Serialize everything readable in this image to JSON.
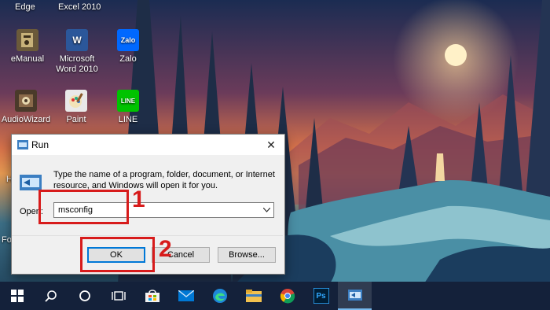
{
  "desktop": {
    "top_labels": [
      "Edge",
      "Excel 2010"
    ],
    "icons": [
      {
        "label_lines": [
          "eManual"
        ],
        "icon": "emanual-icon"
      },
      {
        "label_lines": [
          "Microsoft",
          "Word 2010"
        ],
        "icon": "word-icon",
        "glyph": "W"
      },
      {
        "label_lines": [
          "Zalo"
        ],
        "icon": "zalo-icon",
        "glyph": "Zalo"
      },
      {
        "label_lines": [
          "AudioWizard"
        ],
        "icon": "audiowizard-icon"
      },
      {
        "label_lines": [
          "Paint"
        ],
        "icon": "paint-icon"
      },
      {
        "label_lines": [
          "LINE"
        ],
        "icon": "line-icon",
        "glyph": "LINE"
      }
    ],
    "partial_labels": [
      "H",
      "Fo"
    ]
  },
  "run_dialog": {
    "title": "Run",
    "description": "Type the name of a program, folder, document, or Internet resource, and Windows will open it for you.",
    "open_label": "Open:",
    "open_value": "msconfig",
    "ok_label": "OK",
    "cancel_label": "Cancel",
    "browse_label": "Browse..."
  },
  "annotations": {
    "step1": "1",
    "step2": "2",
    "color": "#d71b1b"
  },
  "taskbar": {
    "items": [
      "start-icon",
      "search-icon",
      "cortana-icon",
      "task-view-icon",
      "store-icon",
      "mail-icon",
      "edge-icon",
      "file-explorer-icon",
      "chrome-icon",
      "photoshop-icon",
      "run-icon"
    ],
    "photoshop_glyph": "Ps"
  }
}
